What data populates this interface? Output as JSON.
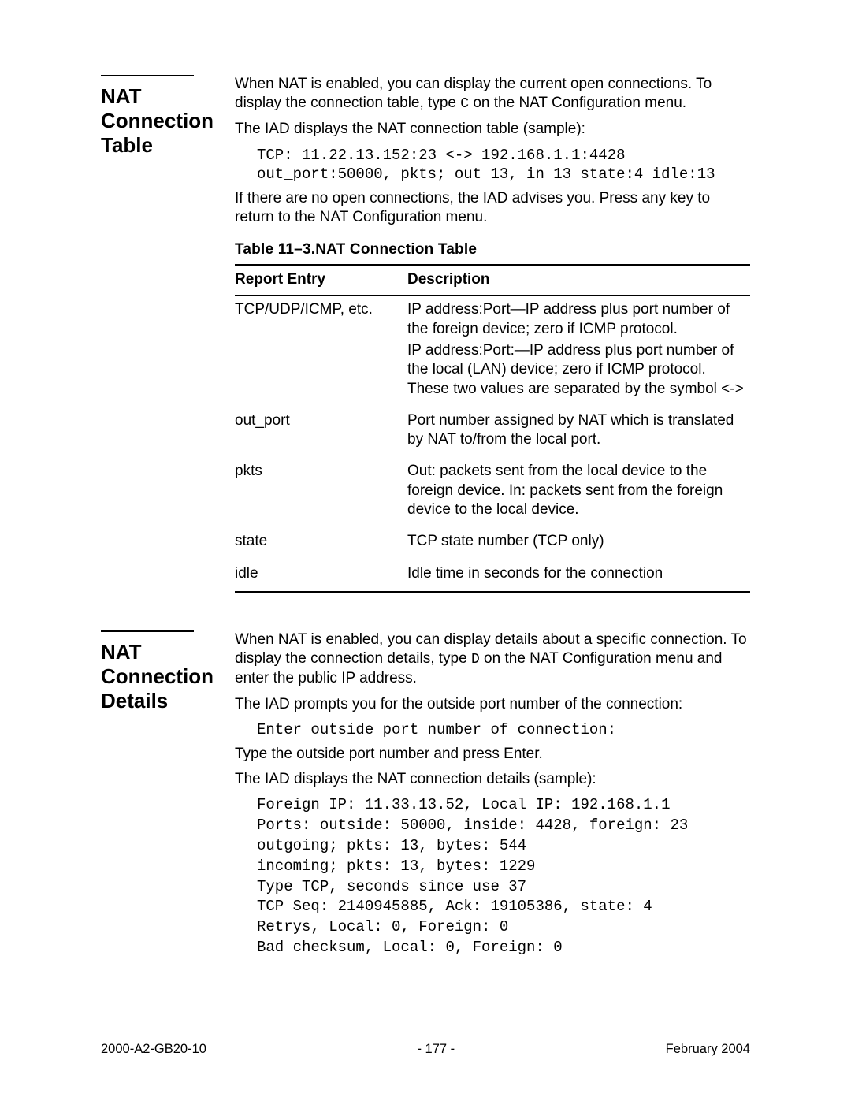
{
  "section1": {
    "heading": "NAT Connection Table",
    "para1a": "When NAT is enabled, you can display the current open connections. To display the connection table, type ",
    "para1_code": "C",
    "para1b": " on the NAT Configuration menu.",
    "para2": "The IAD displays the NAT connection table (sample):",
    "code1_line1": "TCP: 11.22.13.152:23 <-> 192.168.1.1:4428",
    "code1_line2": "out_port:50000, pkts; out 13, in 13 state:4 idle:13",
    "para3": "If there are no open connections, the IAD advises you. Press any key to return to the NAT Configuration menu."
  },
  "table": {
    "caption_prefix": "Table 11–3.",
    "caption_title": "NAT Connection Table",
    "header_col1": "Report Entry",
    "header_col2": "Description",
    "rows": [
      {
        "entry": "TCP/UDP/ICMP, etc.",
        "desc_parts": [
          "IP address:Port—IP address plus port number of the foreign device; zero if ICMP protocol.",
          "IP address:Port:—IP address plus port number of the local (LAN) device; zero if ICMP protocol. These two values are separated by the symbol <->"
        ]
      },
      {
        "entry": "out_port",
        "desc_parts": [
          "Port number assigned by NAT which is translated by NAT to/from the local port."
        ]
      },
      {
        "entry": "pkts",
        "desc_parts": [
          "Out: packets sent from the local device to the foreign device. In: packets sent from the foreign device to the local device."
        ]
      },
      {
        "entry": "state",
        "desc_parts": [
          "TCP state number (TCP only)"
        ]
      },
      {
        "entry": "idle",
        "desc_parts": [
          "Idle time in seconds for the connection"
        ]
      }
    ]
  },
  "section2": {
    "heading": "NAT Connection Details",
    "para1a": "When NAT is enabled, you can display details about a specific connection. To display the connection details, type ",
    "para1_code": "D",
    "para1b": " on the NAT Configuration menu and enter the public IP address.",
    "para2": "The IAD prompts you for the outside port number of the connection:",
    "code1": "Enter outside port number of connection:",
    "para3": "Type the outside port number and press Enter.",
    "para4": "The IAD displays the NAT connection details (sample):",
    "code2_lines": [
      "Foreign IP: 11.33.13.52, Local IP: 192.168.1.1",
      "Ports: outside: 50000, inside: 4428, foreign: 23",
      "outgoing; pkts: 13, bytes: 544",
      "incoming; pkts: 13, bytes: 1229",
      "Type TCP, seconds since use 37",
      "TCP Seq: 2140945885, Ack: 19105386, state: 4",
      "Retrys, Local: 0, Foreign: 0",
      "Bad checksum, Local: 0, Foreign: 0"
    ]
  },
  "footer": {
    "left": "2000-A2-GB20-10",
    "center": "- 177 -",
    "right": "February 2004"
  }
}
